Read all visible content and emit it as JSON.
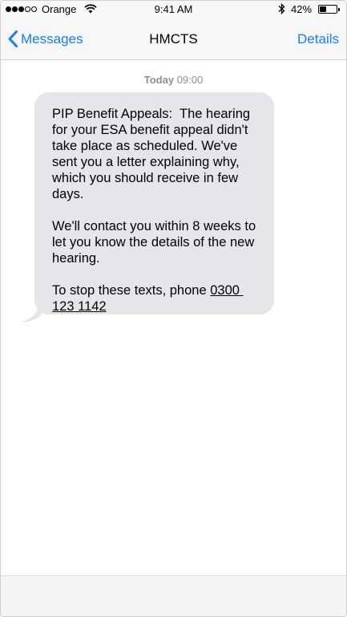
{
  "status_bar": {
    "carrier": "Orange",
    "time": "9:41 AM",
    "battery_percent": "42%",
    "battery_level": 0.42,
    "signal_bars_filled": 3,
    "signal_bars_total": 5
  },
  "nav": {
    "back_label": "Messages",
    "title": "HMCTS",
    "details_label": "Details"
  },
  "conversation": {
    "timestamp_day": "Today",
    "timestamp_time": "09:00",
    "message": {
      "paragraph_1": "PIP Benefit Appeals:  The hearing for your ESA benefit appeal didn't take place as scheduled. We've sent you a letter explaining why, which you should receive in few days.",
      "paragraph_2": "We'll contact you within 8 weeks to let you know the details of the new hearing.",
      "paragraph_3_prefix": "To stop these texts, phone ",
      "phone_number": "0300 123 1142"
    }
  },
  "colors": {
    "accent": "#157efb",
    "bubble": "#e5e5ea",
    "timestamp": "#8e8e93"
  }
}
